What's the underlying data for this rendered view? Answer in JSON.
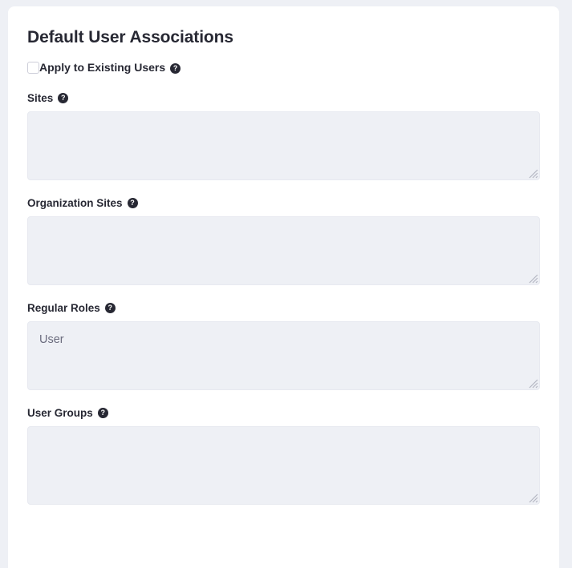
{
  "card": {
    "title": "Default User Associations",
    "apply_existing": {
      "label": "Apply to Existing Users",
      "checked": false,
      "help_glyph": "?"
    },
    "fields": [
      {
        "label": "Sites",
        "help_glyph": "?",
        "value": "",
        "placeholder": "",
        "resizable": true
      },
      {
        "label": "Organization Sites",
        "help_glyph": "?",
        "value": "",
        "placeholder": "",
        "resizable": true
      },
      {
        "label": "Regular Roles",
        "help_glyph": "?",
        "value": "User",
        "placeholder": "",
        "resizable": true
      },
      {
        "label": "User Groups",
        "help_glyph": "?",
        "value": "",
        "placeholder": "",
        "resizable": true
      }
    ]
  },
  "colors": {
    "page_background": "#eef0f5",
    "card_background": "#ffffff",
    "text_primary": "#272833",
    "text_secondary": "#6b6c7e",
    "field_background": "#eef0f5",
    "field_border": "#e7e9f0",
    "help_badge": "#272833"
  }
}
